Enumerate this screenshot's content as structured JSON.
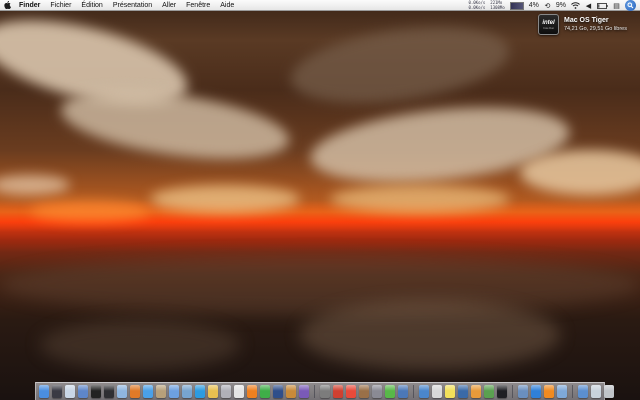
{
  "menubar": {
    "app_name": "Finder",
    "menus": [
      "Fichier",
      "Édition",
      "Présentation",
      "Aller",
      "Fenêtre",
      "Aide"
    ],
    "status": {
      "net_down": "0.0Ko/s",
      "net_up": "0.0Ko/s",
      "mem_used": "221Mo",
      "mem_free": "1308Mo",
      "cpu_percent": "4%",
      "battery_percent": "9%"
    }
  },
  "desktop": {
    "drive": {
      "chip_label": "intel",
      "chip_sub": "Core Duo",
      "name": "Mac OS Tiger",
      "info": "74,21 Go, 29,51 Go libres"
    }
  },
  "dock": {
    "items": [
      {
        "icon": "finder-icon",
        "color": "#4a8ee0"
      },
      {
        "icon": "dashboard-icon",
        "color": "#3a3a44"
      },
      {
        "icon": "mail-icon",
        "color": "#c9d6e6"
      },
      {
        "icon": "ichat-icon",
        "color": "#5e86c9"
      },
      {
        "icon": "terminal-icon",
        "color": "#222222"
      },
      {
        "icon": "activity-monitor-icon",
        "color": "#2f2f33"
      },
      {
        "icon": "camino-icon",
        "color": "#8fb6e0"
      },
      {
        "icon": "firefox-icon",
        "color": "#e07a28"
      },
      {
        "icon": "safari-icon",
        "color": "#4aa0e8"
      },
      {
        "icon": "preview-icon",
        "color": "#b7a07a"
      },
      {
        "icon": "itunes-icon",
        "color": "#6da0df"
      },
      {
        "icon": "iphoto-icon",
        "color": "#77a4cf"
      },
      {
        "icon": "skype-icon",
        "color": "#2c9be0"
      },
      {
        "icon": "adium-icon",
        "color": "#e8c050"
      },
      {
        "icon": "quicksilver-icon",
        "color": "#b0b0b8"
      },
      {
        "icon": "textedit-icon",
        "color": "#e4e4e4"
      },
      {
        "icon": "vlc-icon",
        "color": "#ef8020"
      },
      {
        "icon": "limewire-icon",
        "color": "#3fae48"
      },
      {
        "icon": "photoshop-icon",
        "color": "#2f4e8a"
      },
      {
        "icon": "garageband-icon",
        "color": "#c88a3a"
      },
      {
        "icon": "imovie-icon",
        "color": "#7a5ab8"
      },
      {
        "icon": "separator-a",
        "color": "separator"
      },
      {
        "icon": "calculator-icon",
        "color": "#7c7c7c"
      },
      {
        "icon": "toast-icon",
        "color": "#d04030"
      },
      {
        "icon": "ical-icon",
        "color": "#e84a3a"
      },
      {
        "icon": "address-book-icon",
        "color": "#9a7048"
      },
      {
        "icon": "system-preferences-icon",
        "color": "#8a8a94"
      },
      {
        "icon": "utorrent-icon",
        "color": "#58b848"
      },
      {
        "icon": "xcode-icon",
        "color": "#4c78b8"
      },
      {
        "icon": "separator-b",
        "color": "separator"
      },
      {
        "icon": "network-icon",
        "color": "#4a86cc"
      },
      {
        "icon": "clock-icon",
        "color": "#d8d8d8"
      },
      {
        "icon": "stickies-icon",
        "color": "#f2e05a"
      },
      {
        "icon": "keynote-icon",
        "color": "#3a6aa8"
      },
      {
        "icon": "pages-icon",
        "color": "#e89a3a"
      },
      {
        "icon": "numbers-icon",
        "color": "#5aa050"
      },
      {
        "icon": "dvd-player-icon",
        "color": "#1f1f24"
      },
      {
        "icon": "separator-c",
        "color": "separator"
      },
      {
        "icon": "downloads-stack-icon",
        "color": "#6a8fbf"
      },
      {
        "icon": "app-store-icon",
        "color": "#2f80d8"
      },
      {
        "icon": "vlc-cone-icon",
        "color": "#f08a20"
      },
      {
        "icon": "folder-icon",
        "color": "#7ea8d8"
      },
      {
        "icon": "separator-d",
        "color": "separator"
      },
      {
        "icon": "documents-folder-icon",
        "color": "#5b8fd0"
      },
      {
        "icon": "home-folder-icon",
        "color": "#c8d2dc"
      },
      {
        "icon": "trash-icon",
        "color": "#c0c4c8"
      }
    ]
  }
}
